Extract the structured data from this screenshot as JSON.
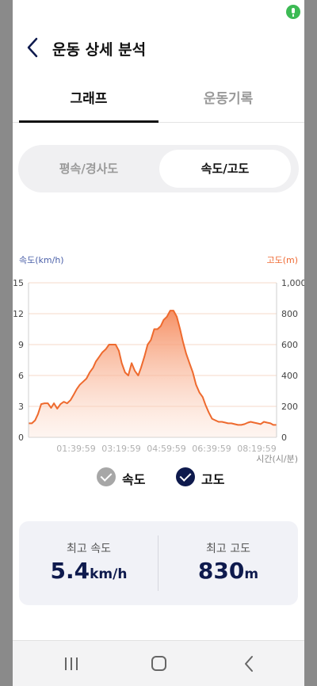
{
  "header": {
    "title": "운동 상세 분석"
  },
  "tabs": [
    {
      "label": "그래프",
      "active": true
    },
    {
      "label": "운동기록",
      "active": false
    }
  ],
  "segment": {
    "options": [
      {
        "label": "평속/경사도",
        "active": false
      },
      {
        "label": "속도/고도",
        "active": true
      }
    ]
  },
  "chart": {
    "left_axis_label": "속도(km/h)",
    "right_axis_label": "고도(m)",
    "x_axis_label": "시간(시/분)",
    "left_ticks": [
      "15",
      "12",
      "9",
      "6",
      "3",
      "0"
    ],
    "right_ticks": [
      "1,000",
      "800",
      "600",
      "400",
      "200",
      "0"
    ],
    "x_ticks": [
      "01:39:59",
      "03:19:59",
      "04:59:59",
      "06:39:59",
      "08:19:59"
    ],
    "colors": {
      "altitude_line": "#ee6a2e",
      "altitude_fill": "#f7a47e",
      "grid": "#f4d9c8",
      "left_axis": "#4a5fa8",
      "right_axis": "#ef6a33"
    }
  },
  "chart_data": {
    "type": "area",
    "series": [
      {
        "name": "고도",
        "x_minutes": [
          0,
          7,
          14,
          20,
          27,
          34,
          41,
          48,
          54,
          61,
          68,
          75,
          82,
          89,
          95,
          102,
          109,
          116,
          123,
          130,
          137,
          143,
          150,
          157,
          164,
          171,
          178,
          185,
          192,
          198,
          205,
          212,
          219,
          226,
          233,
          239,
          246,
          253,
          260,
          267,
          274,
          281,
          287,
          294,
          301,
          308,
          315,
          322,
          328,
          335,
          342,
          349,
          356,
          363,
          370,
          376,
          383,
          390,
          397,
          404,
          411,
          418,
          424,
          431,
          438,
          445,
          452,
          459,
          466,
          472,
          479,
          486,
          493,
          500,
          507,
          514,
          520,
          527
        ],
        "values": [
          90,
          90,
          110,
          150,
          215,
          220,
          220,
          190,
          220,
          185,
          215,
          230,
          220,
          240,
          270,
          310,
          340,
          360,
          380,
          420,
          450,
          490,
          520,
          550,
          570,
          600,
          600,
          600,
          560,
          480,
          420,
          400,
          480,
          430,
          400,
          450,
          520,
          600,
          630,
          700,
          700,
          720,
          760,
          780,
          820,
          820,
          780,
          700,
          620,
          540,
          480,
          420,
          340,
          290,
          260,
          210,
          160,
          120,
          110,
          100,
          100,
          95,
          90,
          90,
          85,
          80,
          80,
          85,
          95,
          100,
          95,
          90,
          85,
          100,
          95,
          90,
          80,
          80
        ]
      },
      {
        "name": "속도",
        "values": []
      }
    ],
    "y_left": {
      "label": "속도(km/h)",
      "range": [
        0,
        15
      ]
    },
    "y_right": {
      "label": "고도(m)",
      "range": [
        0,
        1000
      ]
    },
    "x": {
      "label": "시간(시/분)",
      "ticks": [
        "01:39:59",
        "03:19:59",
        "04:59:59",
        "06:39:59",
        "08:19:59"
      ]
    },
    "legend": [
      {
        "label": "속도",
        "enabled": false
      },
      {
        "label": "고도",
        "enabled": true
      }
    ],
    "grid": true,
    "legend_placement": "bottom"
  },
  "legend": [
    {
      "label": "속도",
      "color": "#a7a7a7"
    },
    {
      "label": "고도",
      "color": "#0e1a4d"
    }
  ],
  "stats": {
    "max_speed": {
      "caption": "최고 속도",
      "value": "5.4",
      "unit": "km/h"
    },
    "max_altitude": {
      "caption": "최고 고도",
      "value": "830",
      "unit": "m"
    }
  }
}
